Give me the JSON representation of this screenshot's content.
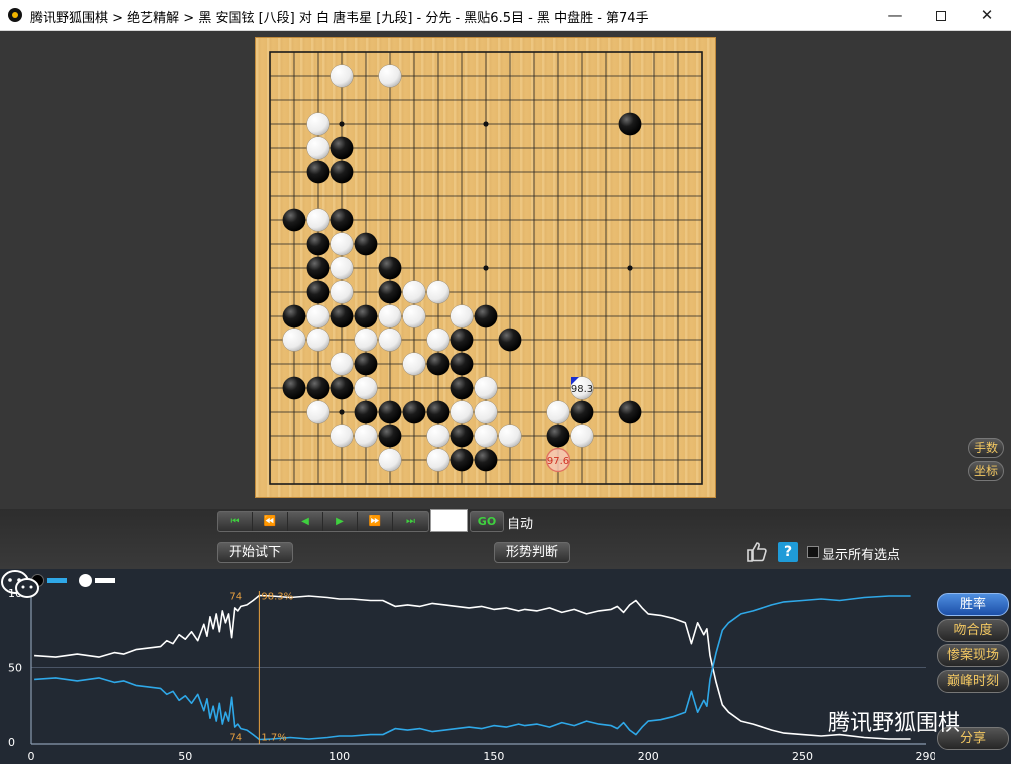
{
  "window": {
    "title": "腾讯野狐围棋 > 绝艺精解 > 黑 安国铉 [八段] 对 白 唐韦星 [九段] - 分先 - 黑贴6.5目 - 黑 中盘胜 - 第74手",
    "minimize": "—",
    "close": "✕"
  },
  "board": {
    "size": 19,
    "black_stones": [
      [
        15,
        3
      ],
      [
        3,
        4
      ],
      [
        2,
        5
      ],
      [
        3,
        5
      ],
      [
        1,
        7
      ],
      [
        3,
        7
      ],
      [
        2,
        8
      ],
      [
        4,
        8
      ],
      [
        2,
        9
      ],
      [
        5,
        9
      ],
      [
        2,
        10
      ],
      [
        5,
        10
      ],
      [
        1,
        11
      ],
      [
        3,
        11
      ],
      [
        4,
        11
      ],
      [
        9,
        11
      ],
      [
        8,
        12
      ],
      [
        10,
        12
      ],
      [
        4,
        13
      ],
      [
        7,
        13
      ],
      [
        8,
        13
      ],
      [
        1,
        14
      ],
      [
        2,
        14
      ],
      [
        3,
        14
      ],
      [
        8,
        14
      ],
      [
        4,
        15
      ],
      [
        5,
        15
      ],
      [
        6,
        15
      ],
      [
        7,
        15
      ],
      [
        13,
        15
      ],
      [
        15,
        15
      ],
      [
        5,
        16
      ],
      [
        8,
        16
      ],
      [
        12,
        16
      ],
      [
        8,
        17
      ],
      [
        9,
        17
      ]
    ],
    "white_stones": [
      [
        3,
        1
      ],
      [
        5,
        1
      ],
      [
        2,
        3
      ],
      [
        2,
        4
      ],
      [
        2,
        7
      ],
      [
        3,
        8
      ],
      [
        3,
        9
      ],
      [
        3,
        10
      ],
      [
        6,
        10
      ],
      [
        7,
        10
      ],
      [
        2,
        11
      ],
      [
        5,
        11
      ],
      [
        6,
        11
      ],
      [
        8,
        11
      ],
      [
        1,
        12
      ],
      [
        2,
        12
      ],
      [
        4,
        12
      ],
      [
        5,
        12
      ],
      [
        7,
        12
      ],
      [
        3,
        13
      ],
      [
        6,
        13
      ],
      [
        4,
        14
      ],
      [
        9,
        14
      ],
      [
        13,
        14
      ],
      [
        2,
        15
      ],
      [
        8,
        15
      ],
      [
        9,
        15
      ],
      [
        12,
        15
      ],
      [
        3,
        16
      ],
      [
        4,
        16
      ],
      [
        7,
        16
      ],
      [
        9,
        16
      ],
      [
        10,
        16
      ],
      [
        13,
        16
      ],
      [
        5,
        17
      ],
      [
        7,
        17
      ]
    ],
    "star_points": [
      [
        3,
        3
      ],
      [
        9,
        3
      ],
      [
        15,
        3
      ],
      [
        3,
        9
      ],
      [
        9,
        9
      ],
      [
        15,
        9
      ],
      [
        3,
        15
      ],
      [
        9,
        15
      ],
      [
        15,
        15
      ]
    ],
    "last_move": {
      "x": 13,
      "y": 14,
      "label": "98.3"
    },
    "candidate": {
      "x": 12,
      "y": 17,
      "label": "97.6"
    }
  },
  "side_buttons": {
    "handnum": "手数",
    "coord": "坐标"
  },
  "controls": {
    "nav": [
      "⏮",
      "⏪",
      "◀",
      "▶",
      "⏩",
      "⏭"
    ],
    "move_input": "",
    "go": "GO",
    "auto": "自动",
    "trial": "开始试下",
    "judge": "形势判断",
    "show_all": "显示所有选点"
  },
  "chart_panel": {
    "buttons": {
      "rate": "胜率",
      "match": "吻合度",
      "tragic": "惨案现场",
      "peak": "巅峰时刻",
      "share": "分享"
    },
    "watermark": "腾讯野狐围棋",
    "colors": {
      "black_series": "#2fa8e8",
      "white_series": "#ffffff",
      "marker": "#e8a040"
    }
  },
  "chart_data": {
    "type": "line",
    "xlim": [
      0,
      290
    ],
    "ylim": [
      0,
      100
    ],
    "x_ticks": [
      "0",
      "50",
      "100",
      "150",
      "200",
      "250",
      "290"
    ],
    "y_ticks": [
      "100",
      "50",
      "0"
    ],
    "marker": {
      "move": 74,
      "white_label": "74",
      "white_value": "98.3%",
      "black_label": "74",
      "black_value": "1.7%"
    },
    "series": [
      {
        "name": "白",
        "color": "#ffffff",
        "points": [
          [
            1,
            58
          ],
          [
            8,
            57
          ],
          [
            15,
            59
          ],
          [
            22,
            57
          ],
          [
            27,
            60
          ],
          [
            30,
            59
          ],
          [
            34,
            62
          ],
          [
            38,
            63
          ],
          [
            42,
            64
          ],
          [
            44,
            68
          ],
          [
            46,
            66
          ],
          [
            48,
            72
          ],
          [
            50,
            69
          ],
          [
            52,
            74
          ],
          [
            54,
            68
          ],
          [
            56,
            79
          ],
          [
            57,
            71
          ],
          [
            58,
            84
          ],
          [
            59,
            76
          ],
          [
            60,
            86
          ],
          [
            61,
            74
          ],
          [
            62,
            88
          ],
          [
            63,
            80
          ],
          [
            64,
            86
          ],
          [
            65,
            70
          ],
          [
            66,
            90
          ],
          [
            67,
            88
          ],
          [
            68,
            91
          ],
          [
            70,
            92
          ],
          [
            72,
            95
          ],
          [
            74,
            98.3
          ],
          [
            78,
            98
          ],
          [
            84,
            97
          ],
          [
            90,
            98
          ],
          [
            96,
            97
          ],
          [
            100,
            96
          ],
          [
            104,
            96
          ],
          [
            110,
            95
          ],
          [
            114,
            95
          ],
          [
            118,
            91
          ],
          [
            122,
            92
          ],
          [
            126,
            91
          ],
          [
            130,
            93
          ],
          [
            134,
            92
          ],
          [
            138,
            91
          ],
          [
            142,
            90
          ],
          [
            146,
            91
          ],
          [
            150,
            89
          ],
          [
            154,
            90
          ],
          [
            158,
            88
          ],
          [
            160,
            89
          ],
          [
            164,
            88
          ],
          [
            168,
            90
          ],
          [
            172,
            87
          ],
          [
            176,
            89
          ],
          [
            180,
            86
          ],
          [
            184,
            88
          ],
          [
            188,
            89
          ],
          [
            190,
            91
          ],
          [
            192,
            87
          ],
          [
            194,
            92
          ],
          [
            196,
            95
          ],
          [
            198,
            90
          ],
          [
            200,
            86
          ],
          [
            204,
            85
          ],
          [
            208,
            83
          ],
          [
            212,
            80
          ],
          [
            214,
            66
          ],
          [
            216,
            80
          ],
          [
            218,
            72
          ],
          [
            219,
            76
          ],
          [
            220,
            58
          ],
          [
            222,
            40
          ],
          [
            224,
            25
          ],
          [
            226,
            20
          ],
          [
            230,
            14
          ],
          [
            234,
            12
          ],
          [
            240,
            8
          ],
          [
            244,
            6
          ],
          [
            250,
            5
          ],
          [
            256,
            4
          ],
          [
            262,
            5
          ],
          [
            270,
            3
          ],
          [
            278,
            2
          ],
          [
            285,
            2
          ]
        ]
      },
      {
        "name": "黑",
        "color": "#2fa8e8",
        "points": [
          [
            1,
            42
          ],
          [
            8,
            43
          ],
          [
            15,
            41
          ],
          [
            22,
            43
          ],
          [
            27,
            40
          ],
          [
            30,
            41
          ],
          [
            34,
            38
          ],
          [
            38,
            37
          ],
          [
            42,
            36
          ],
          [
            44,
            32
          ],
          [
            46,
            34
          ],
          [
            48,
            28
          ],
          [
            50,
            31
          ],
          [
            52,
            26
          ],
          [
            54,
            32
          ],
          [
            56,
            21
          ],
          [
            57,
            29
          ],
          [
            58,
            16
          ],
          [
            59,
            24
          ],
          [
            60,
            14
          ],
          [
            61,
            26
          ],
          [
            62,
            12
          ],
          [
            63,
            20
          ],
          [
            64,
            14
          ],
          [
            65,
            30
          ],
          [
            66,
            10
          ],
          [
            67,
            12
          ],
          [
            68,
            9
          ],
          [
            70,
            8
          ],
          [
            72,
            5
          ],
          [
            74,
            1.7
          ],
          [
            78,
            2
          ],
          [
            84,
            3
          ],
          [
            90,
            2
          ],
          [
            96,
            3
          ],
          [
            100,
            4
          ],
          [
            104,
            4
          ],
          [
            110,
            5
          ],
          [
            114,
            5
          ],
          [
            118,
            9
          ],
          [
            122,
            8
          ],
          [
            126,
            9
          ],
          [
            130,
            7
          ],
          [
            134,
            8
          ],
          [
            138,
            9
          ],
          [
            142,
            10
          ],
          [
            146,
            9
          ],
          [
            150,
            11
          ],
          [
            154,
            10
          ],
          [
            158,
            12
          ],
          [
            160,
            11
          ],
          [
            164,
            12
          ],
          [
            168,
            10
          ],
          [
            172,
            13
          ],
          [
            176,
            11
          ],
          [
            180,
            14
          ],
          [
            184,
            12
          ],
          [
            188,
            11
          ],
          [
            190,
            9
          ],
          [
            192,
            13
          ],
          [
            194,
            8
          ],
          [
            196,
            5
          ],
          [
            198,
            10
          ],
          [
            200,
            14
          ],
          [
            204,
            15
          ],
          [
            208,
            17
          ],
          [
            212,
            20
          ],
          [
            214,
            34
          ],
          [
            216,
            20
          ],
          [
            218,
            28
          ],
          [
            219,
            24
          ],
          [
            220,
            42
          ],
          [
            222,
            60
          ],
          [
            224,
            75
          ],
          [
            226,
            80
          ],
          [
            230,
            86
          ],
          [
            234,
            88
          ],
          [
            240,
            92
          ],
          [
            244,
            94
          ],
          [
            250,
            95
          ],
          [
            256,
            96
          ],
          [
            262,
            95
          ],
          [
            270,
            97
          ],
          [
            278,
            98
          ],
          [
            285,
            98
          ]
        ]
      }
    ]
  }
}
